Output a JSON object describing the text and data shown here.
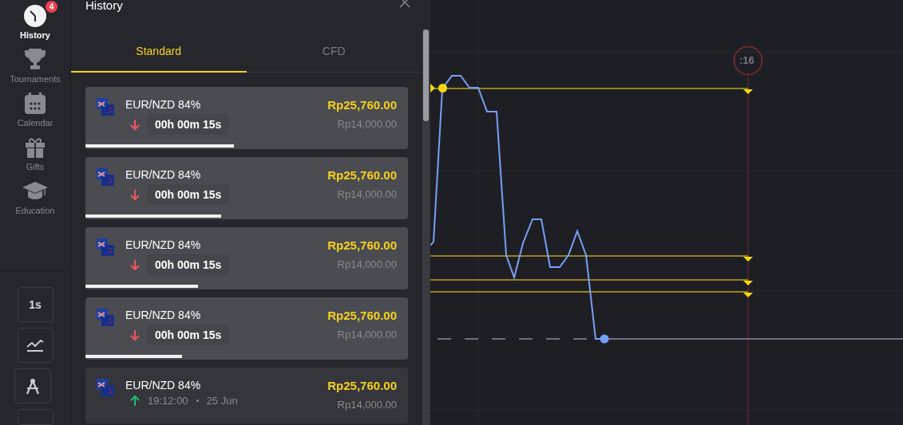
{
  "nav": {
    "items": [
      {
        "label": "History",
        "selected": true,
        "badge": "4"
      },
      {
        "label": "Tournaments",
        "selected": false
      },
      {
        "label": "Calendar",
        "selected": false
      },
      {
        "label": "Gifts",
        "selected": false
      },
      {
        "label": "Education",
        "selected": false
      }
    ],
    "tools": [
      {
        "kind": "text",
        "label": "1s"
      },
      {
        "kind": "line"
      },
      {
        "kind": "draw"
      },
      {
        "kind": "more"
      }
    ]
  },
  "panel": {
    "title": "History",
    "tabs": [
      {
        "label": "Standard",
        "selected": true
      },
      {
        "label": "CFD",
        "selected": false
      }
    ],
    "trades": [
      {
        "kind": "active",
        "asset": "EUR/NZD 84%",
        "rising": false,
        "timer": "00h 00m 15s",
        "payout": "Rp25,760.00",
        "amount": "Rp14,000.00",
        "level": 0.46
      },
      {
        "kind": "active",
        "asset": "EUR/NZD 84%",
        "rising": false,
        "timer": "00h 00m 15s",
        "payout": "Rp25,760.00",
        "amount": "Rp14,000.00",
        "level": 0.42
      },
      {
        "kind": "active",
        "asset": "EUR/NZD 84%",
        "rising": false,
        "timer": "00h 00m 15s",
        "payout": "Rp25,760.00",
        "amount": "Rp14,000.00",
        "level": 0.35
      },
      {
        "kind": "active",
        "asset": "EUR/NZD 84%",
        "rising": false,
        "timer": "00h 00m 15s",
        "payout": "Rp25,760.00",
        "amount": "Rp14,000.00",
        "level": 0.3
      },
      {
        "kind": "closed",
        "asset": "EUR/NZD 84%",
        "rising": true,
        "time": "19:12:00",
        "date": "25 Jun",
        "payout": "Rp25,760.00",
        "amount": "Rp14,000.00"
      }
    ]
  },
  "chart": {
    "countdown": ":16"
  }
}
